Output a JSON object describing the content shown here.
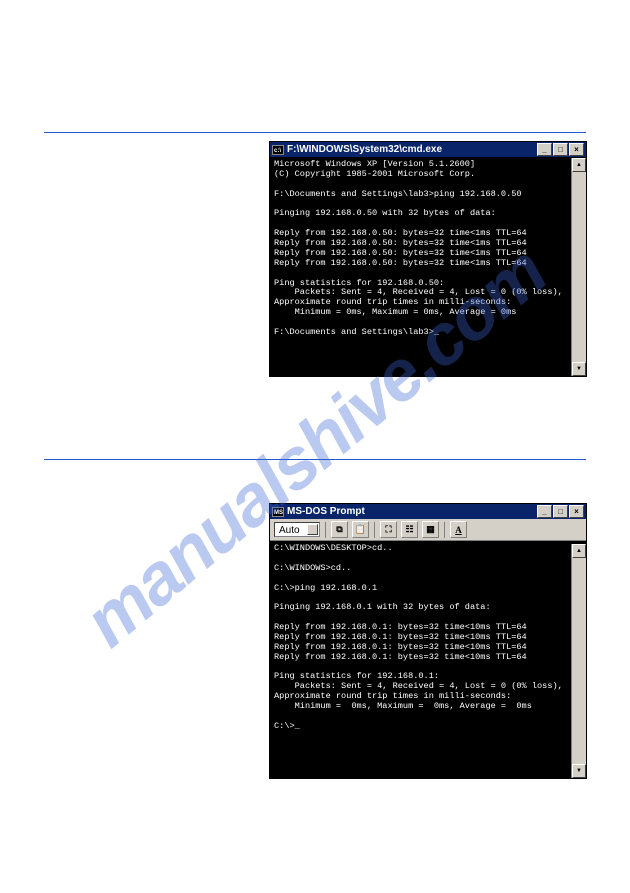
{
  "watermark": "manualshive.com",
  "cmd": {
    "title": "F:\\WINDOWS\\System32\\cmd.exe",
    "body": "Microsoft Windows XP [Version 5.1.2600]\n(C) Copyright 1985-2001 Microsoft Corp.\n\nF:\\Documents and Settings\\lab3>ping 192.168.0.50\n\nPinging 192.168.0.50 with 32 bytes of data:\n\nReply from 192.168.0.50: bytes=32 time<1ms TTL=64\nReply from 192.168.0.50: bytes=32 time<1ms TTL=64\nReply from 192.168.0.50: bytes=32 time<1ms TTL=64\nReply from 192.168.0.50: bytes=32 time<1ms TTL=64\n\nPing statistics for 192.168.0.50:\n    Packets: Sent = 4, Received = 4, Lost = 0 (0% loss),\nApproximate round trip times in milli-seconds:\n    Minimum = 0ms, Maximum = 0ms, Average = 0ms\n\nF:\\Documents and Settings\\lab3>_"
  },
  "dos": {
    "title": "MS-DOS Prompt",
    "toolbar": {
      "font": "Auto"
    },
    "body": "C:\\WINDOWS\\DESKTOP>cd..\n\nC:\\WINDOWS>cd..\n\nC:\\>ping 192.168.0.1\n\nPinging 192.168.0.1 with 32 bytes of data:\n\nReply from 192.168.0.1: bytes=32 time<10ms TTL=64\nReply from 192.168.0.1: bytes=32 time<10ms TTL=64\nReply from 192.168.0.1: bytes=32 time<10ms TTL=64\nReply from 192.168.0.1: bytes=32 time<10ms TTL=64\n\nPing statistics for 192.168.0.1:\n    Packets: Sent = 4, Received = 4, Lost = 0 (0% loss),\nApproximate round trip times in milli-seconds:\n    Minimum =  0ms, Maximum =  0ms, Average =  0ms\n\nC:\\>_"
  }
}
